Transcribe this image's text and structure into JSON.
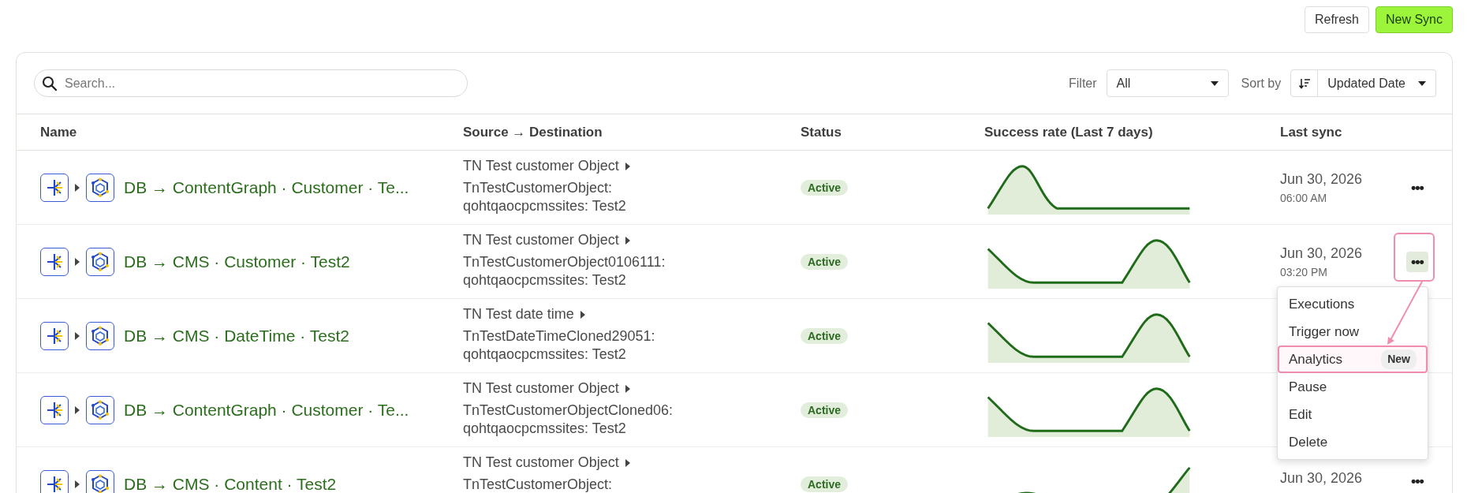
{
  "toolbar": {
    "buttons": [
      {
        "label": "Refresh",
        "kind": "secondary"
      },
      {
        "label": "New Sync",
        "kind": "primary"
      }
    ]
  },
  "search": {
    "placeholder": "Search..."
  },
  "filter": {
    "label": "Filter",
    "value": "All"
  },
  "sort": {
    "label": "Sort by",
    "value": "Updated Date"
  },
  "table": {
    "columns": [
      "Name",
      "Source → Destination",
      "Status",
      "Success rate (Last 7 days)",
      "Last sync"
    ],
    "rows": [
      {
        "name": "DB → ContentGraph · Customer · Te...",
        "source": "TN Test customer Object",
        "destination": [
          "TnTestCustomerObject:",
          "qohtqaocpcmssites: Test2"
        ],
        "status": "Active",
        "sparkline": {
          "kind": "early"
        },
        "date": "Jun 30, 2026",
        "time": "06:00 AM",
        "menu_button": "•••",
        "menu_open": false
      },
      {
        "name": "DB → CMS · Customer · Test2",
        "source": "TN Test customer Object",
        "destination": [
          "TnTestCustomerObject0106111:",
          "qohtqaocpcmssites: Test2"
        ],
        "status": "Active",
        "sparkline": {
          "kind": "late"
        },
        "date": "Jun 30, 2026",
        "time": "03:20 PM",
        "menu_button": "•••",
        "menu_open": true
      },
      {
        "name": "DB → CMS · DateTime · Test2",
        "source": "TN Test date time",
        "destination": [
          "TnTestDateTimeCloned29051:",
          "qohtqaocpcmssites: Test2"
        ],
        "status": "Active",
        "sparkline": {
          "kind": "late"
        }
      },
      {
        "name": "DB → ContentGraph · Customer · Te...",
        "source": "TN Test customer Object",
        "destination": [
          "TnTestCustomerObjectCloned06:",
          "qohtqaocpcmssites: Test2"
        ],
        "status": "Active",
        "sparkline": {
          "kind": "late"
        }
      },
      {
        "name": "DB → CMS · Content · Test2",
        "source": "TN Test customer Object",
        "destination": [
          "TnTestCustomerObject:"
        ],
        "status": "Active",
        "sparkline": {
          "kind": "rising"
        },
        "date": "Jun 30, 2026",
        "menu_button": "•••",
        "menu_open": false
      }
    ]
  },
  "row_menu": {
    "items": [
      {
        "label": "Executions",
        "highlighted": false
      },
      {
        "label": "Trigger now",
        "highlighted": false
      },
      {
        "label": "Analytics",
        "badge": "New",
        "highlighted": true
      },
      {
        "label": "Pause",
        "highlighted": false
      },
      {
        "label": "Edit",
        "highlighted": false
      },
      {
        "label": "Delete",
        "highlighted": false
      }
    ]
  }
}
